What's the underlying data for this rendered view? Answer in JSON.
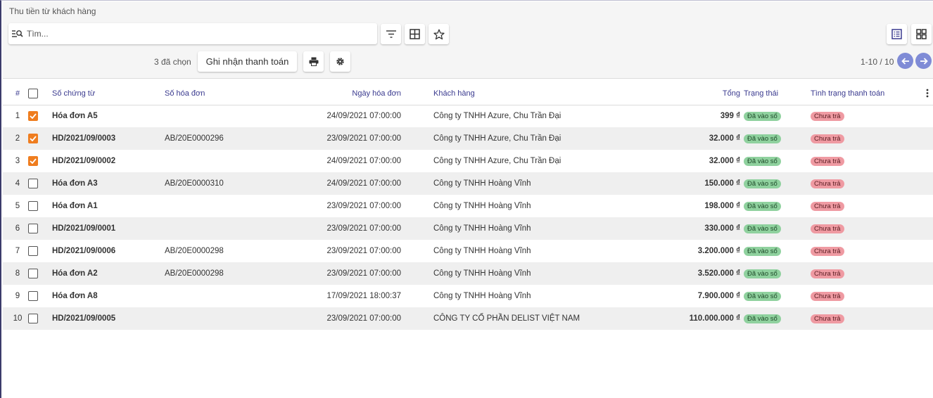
{
  "breadcrumb": "Thu tiền từ khách hàng",
  "search": {
    "placeholder": "Tìm..."
  },
  "selection": {
    "label": "3 đã chọn"
  },
  "actions": {
    "register_payment": "Ghi nhận thanh toán"
  },
  "pager": {
    "range": "1-10 / 10"
  },
  "colors": {
    "accent": "#ef7d1f",
    "pager": "#7f8bd6",
    "header_text": "#3a3a8f"
  },
  "table": {
    "headers": {
      "num": "#",
      "doc": "Số chứng từ",
      "inv": "Số hóa đơn",
      "date": "Ngày hóa đơn",
      "cust": "Khách hàng",
      "total": "Tổng",
      "status": "Trạng thái",
      "pay": "Tình trạng thanh toán"
    },
    "rows": [
      {
        "num": "1",
        "checked": true,
        "doc": "Hóa đơn A5",
        "inv": "",
        "date": "24/09/2021 07:00:00",
        "cust": "Công ty TNHH Azure, Chu Trần Đại",
        "total": "399 ₫",
        "status": "Đã vào sổ",
        "pay": "Chưa trả"
      },
      {
        "num": "2",
        "checked": true,
        "doc": "HD/2021/09/0003",
        "inv": "AB/20E0000296",
        "date": "23/09/2021 07:00:00",
        "cust": "Công ty TNHH Azure, Chu Trần Đại",
        "total": "32.000 ₫",
        "status": "Đã vào sổ",
        "pay": "Chưa trả"
      },
      {
        "num": "3",
        "checked": true,
        "doc": "HD/2021/09/0002",
        "inv": "",
        "date": "24/09/2021 07:00:00",
        "cust": "Công ty TNHH Azure, Chu Trần Đại",
        "total": "32.000 ₫",
        "status": "Đã vào sổ",
        "pay": "Chưa trả"
      },
      {
        "num": "4",
        "checked": false,
        "doc": "Hóa đơn A3",
        "inv": "AB/20E0000310",
        "date": "24/09/2021 07:00:00",
        "cust": "Công ty TNHH Hoàng Vĩnh",
        "total": "150.000 ₫",
        "status": "Đã vào sổ",
        "pay": "Chưa trả"
      },
      {
        "num": "5",
        "checked": false,
        "doc": "Hóa đơn A1",
        "inv": "",
        "date": "23/09/2021 07:00:00",
        "cust": "Công ty TNHH Hoàng Vĩnh",
        "total": "198.000 ₫",
        "status": "Đã vào sổ",
        "pay": "Chưa trả"
      },
      {
        "num": "6",
        "checked": false,
        "doc": "HD/2021/09/0001",
        "inv": "",
        "date": "23/09/2021 07:00:00",
        "cust": "Công ty TNHH Hoàng Vĩnh",
        "total": "330.000 ₫",
        "status": "Đã vào sổ",
        "pay": "Chưa trả"
      },
      {
        "num": "7",
        "checked": false,
        "doc": "HD/2021/09/0006",
        "inv": "AB/20E0000298",
        "date": "23/09/2021 07:00:00",
        "cust": "Công ty TNHH Hoàng Vĩnh",
        "total": "3.200.000 ₫",
        "status": "Đã vào sổ",
        "pay": "Chưa trả"
      },
      {
        "num": "8",
        "checked": false,
        "doc": "Hóa đơn A2",
        "inv": "AB/20E0000298",
        "date": "23/09/2021 07:00:00",
        "cust": "Công ty TNHH Hoàng Vĩnh",
        "total": "3.520.000 ₫",
        "status": "Đã vào sổ",
        "pay": "Chưa trả"
      },
      {
        "num": "9",
        "checked": false,
        "doc": "Hóa đơn A8",
        "inv": "",
        "date": "17/09/2021 18:00:37",
        "cust": "Công ty TNHH Hoàng Vĩnh",
        "total": "7.900.000 ₫",
        "status": "Đã vào sổ",
        "pay": "Chưa trả"
      },
      {
        "num": "10",
        "checked": false,
        "doc": "HD/2021/09/0005",
        "inv": "",
        "date": "23/09/2021 07:00:00",
        "cust": "CÔNG TY CỔ PHẦN DELIST VIỆT NAM",
        "total": "110.000.000 ₫",
        "status": "Đã vào sổ",
        "pay": "Chưa trả"
      }
    ]
  }
}
